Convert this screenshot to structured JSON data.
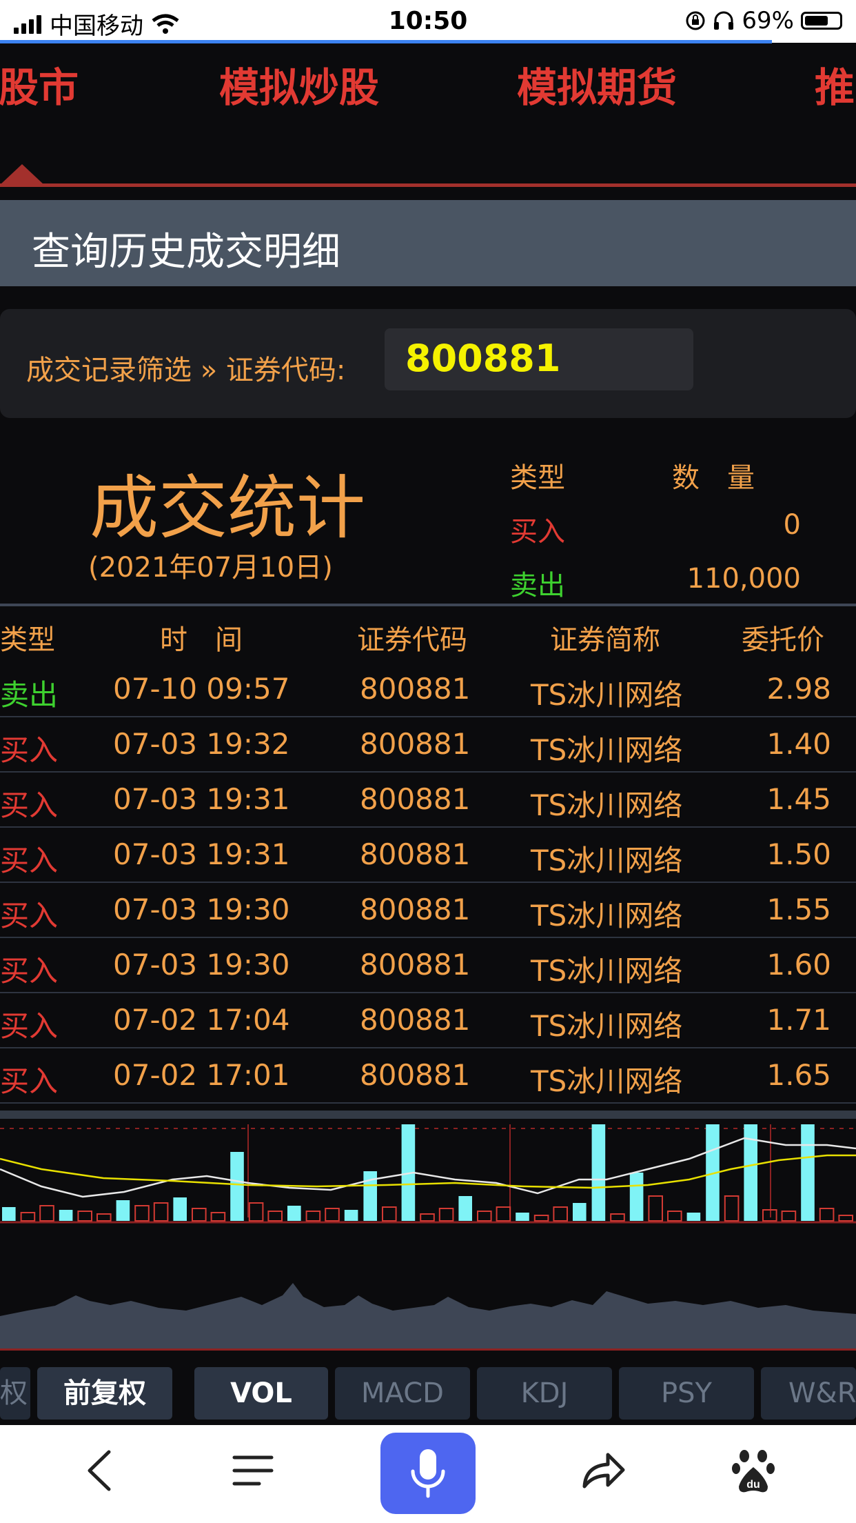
{
  "status_bar": {
    "carrier": "中国移动",
    "time": "10:50",
    "battery": "69%"
  },
  "nav": {
    "tabs": [
      "股市",
      "模拟炒股",
      "模拟期货",
      "推"
    ]
  },
  "header": {
    "title": "查询历史成交明细"
  },
  "filter": {
    "label": "成交记录筛选 » 证券代码:",
    "code": "800881"
  },
  "stats": {
    "title": "成交统计",
    "date": "(2021年07月10日)",
    "col_type": "类型",
    "col_qty": "数　量",
    "buy_label": "买入",
    "buy_qty": "0",
    "sell_label": "卖出",
    "sell_qty": "110,000"
  },
  "table": {
    "headers": [
      "类型",
      "时　间",
      "证券代码",
      "证券简称",
      "委托价"
    ],
    "rows": [
      {
        "type": "卖出",
        "time": "07-10 09:57",
        "code": "800881",
        "name": "TS冰川网络",
        "price": "2.98"
      },
      {
        "type": "买入",
        "time": "07-03 19:32",
        "code": "800881",
        "name": "TS冰川网络",
        "price": "1.40"
      },
      {
        "type": "买入",
        "time": "07-03 19:31",
        "code": "800881",
        "name": "TS冰川网络",
        "price": "1.45"
      },
      {
        "type": "买入",
        "time": "07-03 19:31",
        "code": "800881",
        "name": "TS冰川网络",
        "price": "1.50"
      },
      {
        "type": "买入",
        "time": "07-03 19:30",
        "code": "800881",
        "name": "TS冰川网络",
        "price": "1.55"
      },
      {
        "type": "买入",
        "time": "07-03 19:30",
        "code": "800881",
        "name": "TS冰川网络",
        "price": "1.60"
      },
      {
        "type": "买入",
        "time": "07-02 17:04",
        "code": "800881",
        "name": "TS冰川网络",
        "price": "1.71"
      },
      {
        "type": "买入",
        "time": "07-02 17:01",
        "code": "800881",
        "name": "TS冰川网络",
        "price": "1.65"
      }
    ]
  },
  "indicators": {
    "items": [
      "权",
      "前复权",
      "VOL",
      "MACD",
      "KDJ",
      "PSY",
      "W&R"
    ],
    "active": "VOL"
  },
  "colors": {
    "sell": "#3ed12f",
    "buy": "#e23a33",
    "accent": "#f2a14a",
    "volume_up": "#7ff3f6",
    "volume_down": "#d23a33"
  },
  "toolbar": {
    "icons": [
      "back-icon",
      "menu-icon",
      "microphone-icon",
      "share-icon",
      "baidu-paw-icon"
    ]
  }
}
